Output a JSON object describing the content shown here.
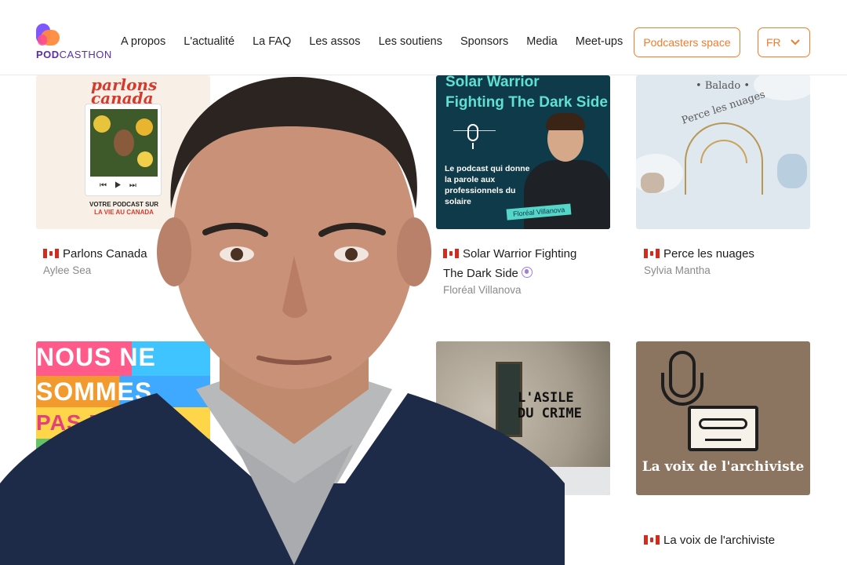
{
  "header": {
    "logo": {
      "text_bold": "POD",
      "text_regular": "CASTHON"
    },
    "nav": [
      "A propos",
      "L'actualité",
      "La FAQ",
      "Les assos",
      "Les soutiens",
      "Sponsors",
      "Media",
      "Meet-ups"
    ],
    "podcasters_button": "Podcasters space",
    "language": "FR"
  },
  "colors": {
    "accent": "#f07c2e",
    "brand": "#5a2ea6"
  },
  "cards": [
    {
      "title": "Parlons Canada",
      "author": "Aylee Sea",
      "cover": {
        "brand": "parlons canada",
        "slogan_line1": "VOTRE PODCAST SUR",
        "slogan_line2": "LA VIE AU CANADA"
      }
    },
    {
      "title_line1": "Solar Warrior Fighting",
      "title_line2": "The Dark Side",
      "author": "Floréal Villanova",
      "cover": {
        "title1": "Solar Warrior",
        "title2": "Fighting The Dark Side",
        "description": "Le podcast qui donne la parole aux professionnels du solaire",
        "tag": "Floréal Villanova"
      }
    },
    {
      "title": "Perce les nuages",
      "author": "Sylvia Mantha",
      "cover": {
        "balado": "Balado",
        "arc_text": "Perce les nuages"
      }
    },
    {
      "title": "",
      "author": "",
      "cover": {
        "line1": "NOUS NE",
        "line2": "SOMMES",
        "line3": "PAS PA"
      }
    },
    {
      "title": "",
      "author": "",
      "cover": {
        "line1": "L'ASILE",
        "line2": "DU CRIME"
      }
    },
    {
      "title": "La voix de l'archiviste",
      "author": "",
      "cover": {
        "title": "La voix de l'archiviste"
      }
    }
  ]
}
